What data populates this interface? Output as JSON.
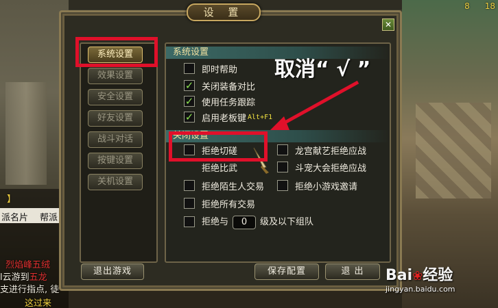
{
  "hud": {
    "stat_left": "8",
    "stat_right": "18"
  },
  "chat": {
    "line1": "】",
    "card_left": "派名片",
    "card_right": "帮派",
    "line2": "烈焰峰五绒",
    "line3_a": "l云游到",
    "line3_b": "五龙",
    "line4": "支进行指点, 徒",
    "line5": "这过来"
  },
  "dialog": {
    "title": "设 置",
    "close_label": "✕",
    "menu": [
      {
        "label": "系统设置",
        "active": true
      },
      {
        "label": "效果设置",
        "active": false
      },
      {
        "label": "安全设置",
        "active": false
      },
      {
        "label": "好友设置",
        "active": false
      },
      {
        "label": "战斗对话",
        "active": false
      },
      {
        "label": "按键设置",
        "active": false
      },
      {
        "label": "关机设置",
        "active": false
      }
    ],
    "system_section": {
      "header": "系统设置",
      "options": [
        {
          "label": "即时帮助",
          "checked": false
        },
        {
          "label": "关闭装备对比",
          "checked": true
        },
        {
          "label": "使用任务跟踪",
          "checked": true
        },
        {
          "label": "启用老板键",
          "key": "Alt+F1",
          "checked": true
        }
      ]
    },
    "refuse_section": {
      "header": "关闭设置",
      "left_options": [
        {
          "label": "拒绝切磋",
          "checked": false
        },
        {
          "label": "拒绝比武",
          "checked": false
        },
        {
          "label": "拒绝陌生人交易",
          "checked": false
        },
        {
          "label": "拒绝所有交易",
          "checked": false
        }
      ],
      "right_options": [
        {
          "label": "龙宫献艺拒绝应战",
          "checked": false
        },
        {
          "label": "斗宠大会拒绝应战",
          "checked": false
        },
        {
          "label": "拒绝小游戏邀请",
          "checked": false
        }
      ],
      "team_option": {
        "prefix": "拒绝与",
        "value": "0",
        "suffix": "级及以下组队",
        "checked": false
      }
    },
    "buttons": {
      "exit_game": "退出游戏",
      "save_config": "保存配置",
      "exit": "退 出"
    }
  },
  "annotation": {
    "text": "取消“ √ ”",
    "color": "#e0102a"
  },
  "watermark": {
    "logo": "Bai",
    "logo_cn": "经验",
    "url": "jingyan.baidu.com"
  }
}
